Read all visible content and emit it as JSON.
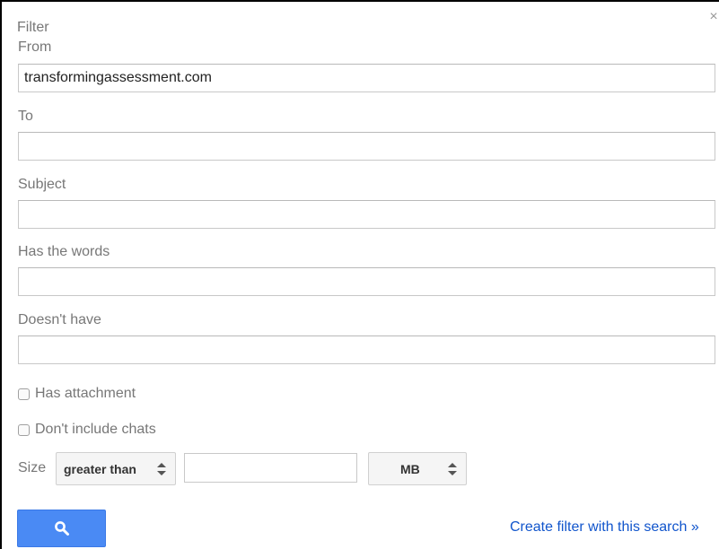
{
  "dialog": {
    "title": "Filter",
    "close_icon": "×"
  },
  "fields": {
    "from": {
      "label": "From",
      "value": "transformingassessment.com"
    },
    "to": {
      "label": "To",
      "value": ""
    },
    "subject": {
      "label": "Subject",
      "value": ""
    },
    "has_words": {
      "label": "Has the words",
      "value": ""
    },
    "doesnt_have": {
      "label": "Doesn't have",
      "value": ""
    }
  },
  "checkboxes": {
    "has_attachment": {
      "label": "Has attachment",
      "checked": false
    },
    "dont_include_chats": {
      "label": "Don't include chats",
      "checked": false
    }
  },
  "size": {
    "label": "Size",
    "comparator": "greater than",
    "value": "",
    "unit": "MB"
  },
  "actions": {
    "search_icon": "search-icon",
    "create_filter_link": "Create filter with this search »"
  },
  "colors": {
    "primary_button": "#4a8af4",
    "link": "#1155cc",
    "label_text": "#777777"
  }
}
